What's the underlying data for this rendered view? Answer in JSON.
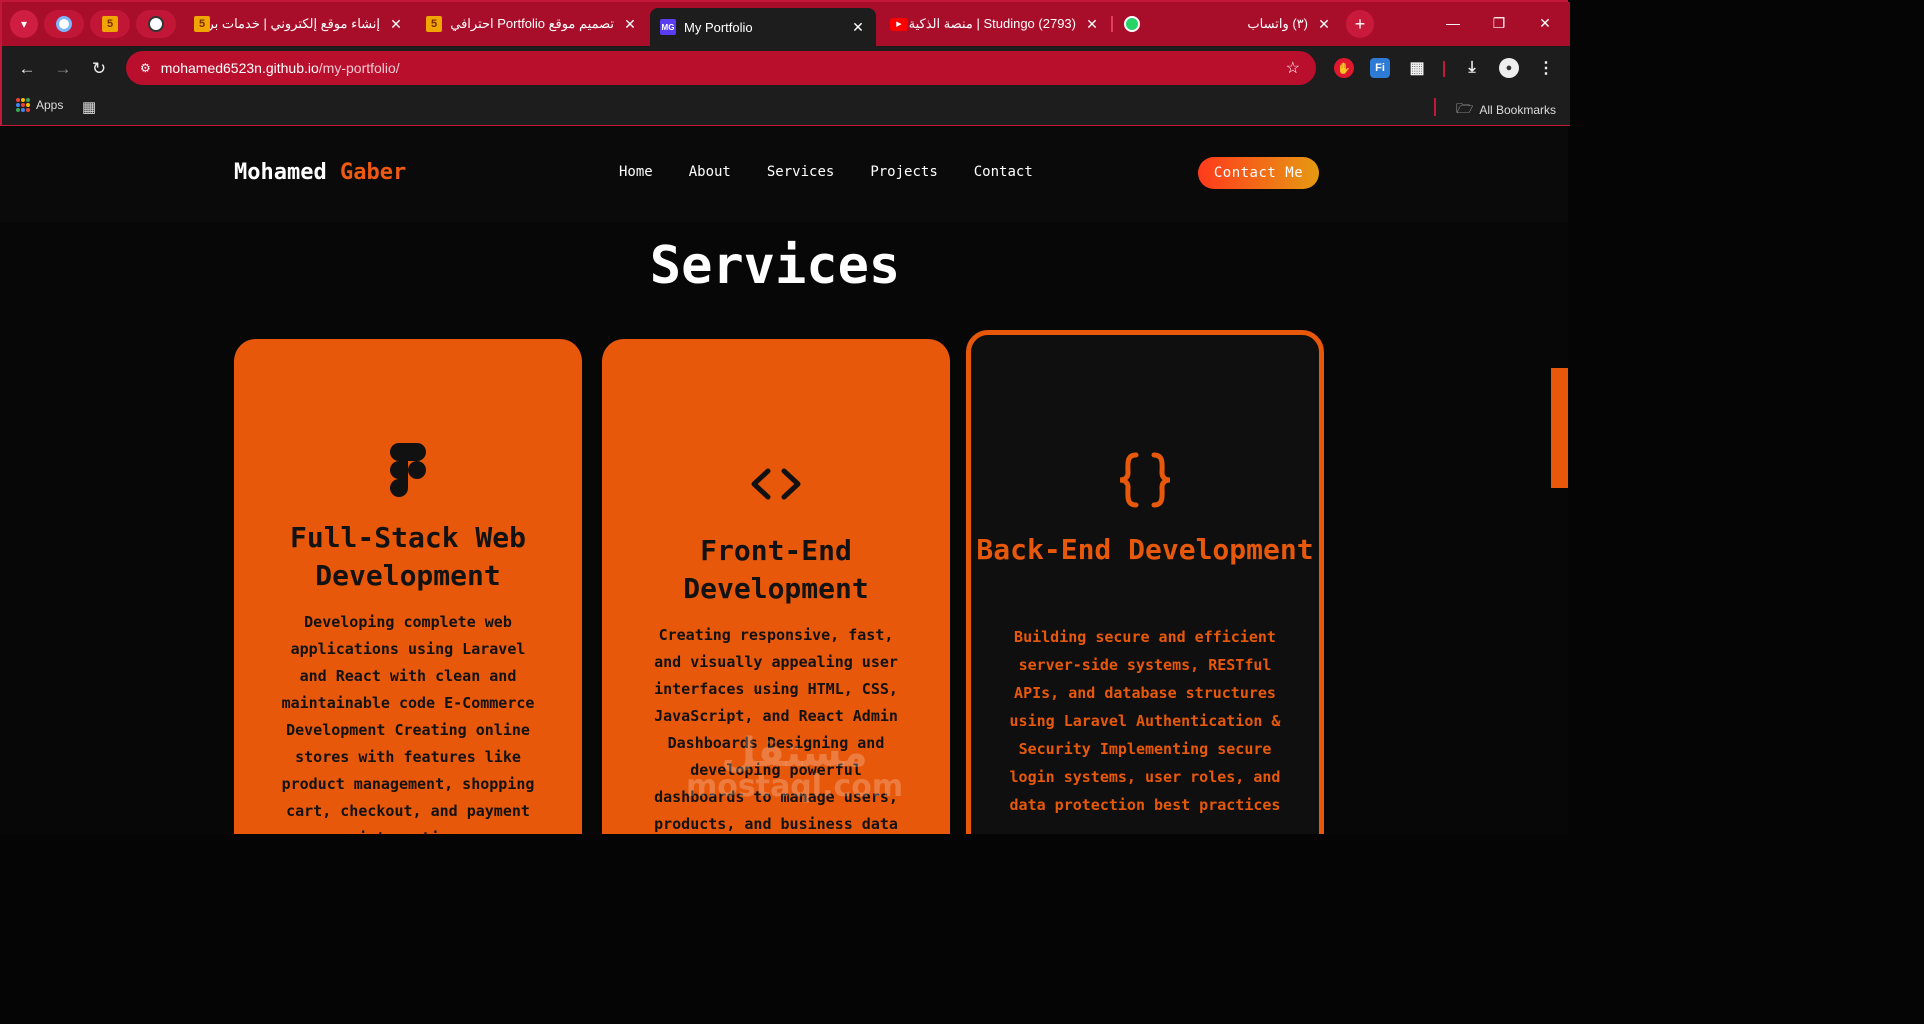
{
  "browser": {
    "tabs": [
      {
        "title": "إنشاء موقع إلكتروني | خدمات بر",
        "favicon": "5"
      },
      {
        "title": "تصميم موقع Portfolio احترافي",
        "favicon": "5"
      },
      {
        "title": "My Portfolio",
        "favicon": "MG"
      },
      {
        "title": "(2793) Studingo | منصة الذكية",
        "favicon": "youtube-icon"
      },
      {
        "title": "(٣) واتساب",
        "favicon": "whatsapp-icon"
      }
    ],
    "pinned_favicon_label": "5",
    "url_host": "mohamed6523n.github.io",
    "url_path": "/my-portfolio/",
    "bookmarks": {
      "apps_label": "Apps",
      "all_label": "All Bookmarks"
    },
    "colors": {
      "frame": "#b3112e",
      "omnibox": "#b90f2d",
      "toolbar": "#1d1d1d"
    }
  },
  "site": {
    "logo_first": "Mohamed",
    "logo_second": "Gaber",
    "nav": [
      "Home",
      "About",
      "Services",
      "Projects",
      "Contact"
    ],
    "cta_label": "Contact Me",
    "accent_color": "#e8580b",
    "section_title": "Services",
    "cards": [
      {
        "icon": "figma-icon",
        "title": "Full-Stack Web Development",
        "description": "Developing complete web applications using Laravel and React with clean and maintainable code E-Commerce Development Creating online stores with features like product management, shopping cart, checkout, and payment integration"
      },
      {
        "icon": "code-brackets-icon",
        "title": "Front-End Development",
        "description": "Creating responsive, fast, and visually appealing user interfaces using HTML, CSS, JavaScript, and React Admin Dashboards Designing and developing powerful dashboards to manage users, products, and business data"
      },
      {
        "icon": "curly-braces-icon",
        "title": "Back-End Development",
        "description": "Building secure and efficient server-side systems, RESTful APIs, and database structures using Laravel Authentication & Security Implementing secure login systems, user roles, and data protection best practices"
      }
    ],
    "watermark": {
      "line1": "مستقل",
      "line2": "mostaql.com"
    }
  }
}
